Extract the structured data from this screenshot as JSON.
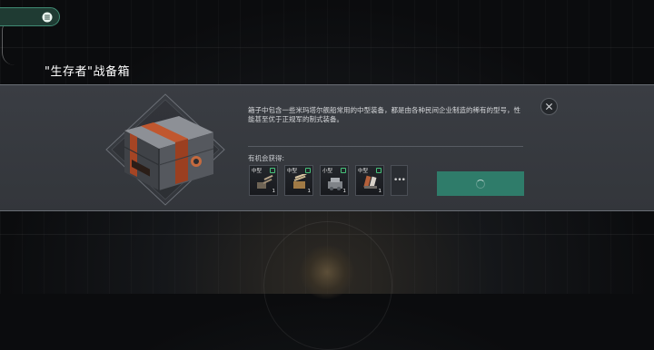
{
  "header": {
    "menu_icon": "hamburger-icon",
    "crate_title": "\"生存者\"战备箱"
  },
  "panel": {
    "close_icon": "close-icon",
    "description": "箱子中包含一些米玛塔尔舰船常用的中型装备，都是由各种民间企业制造的稀有的型号，性能甚至优于正规军的制式装备。",
    "chance_label": "有机会获得:",
    "items": [
      {
        "type": "中型",
        "count": "1",
        "icon": "cannon-icon"
      },
      {
        "type": "中型",
        "count": "1",
        "icon": "autocannon-icon"
      },
      {
        "type": "小型",
        "count": "1",
        "icon": "turret-icon"
      },
      {
        "type": "中型",
        "count": "1",
        "icon": "launcher-icon"
      }
    ],
    "more_label": "•••",
    "open_button_state": "loading"
  },
  "colors": {
    "accent": "#2f7c6a",
    "menu_border": "#3f8a73",
    "badge": "#46c37a",
    "panel_bg": "#383b40",
    "crate_strap": "#c0572f"
  }
}
